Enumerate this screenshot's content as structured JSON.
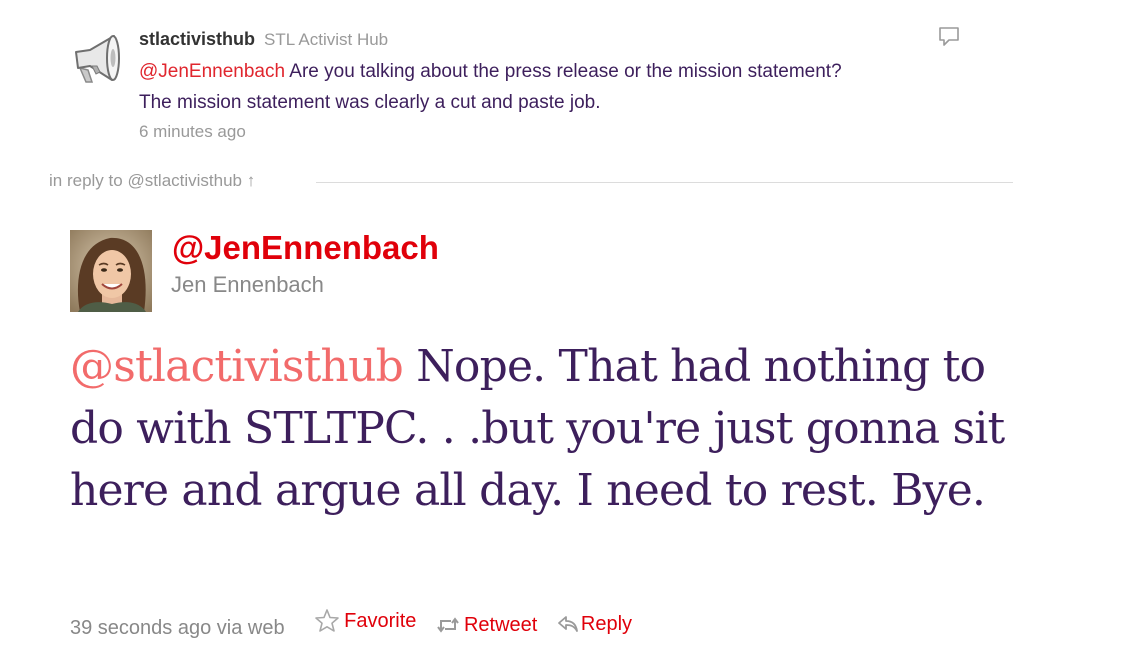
{
  "parent_tweet": {
    "screen_name": "stlactivisthub",
    "full_name": "STL Activist Hub",
    "mention": "@JenEnnenbach",
    "text_rest": "Are you talking about the press release or the mission statement?",
    "text_line2": "The mission statement was clearly a cut and paste job.",
    "timestamp": "6 minutes ago"
  },
  "in_reply": {
    "prefix": "in reply to",
    "link": "@stlactivisthub",
    "arrow": "↑"
  },
  "main_tweet": {
    "screen_name": "@JenEnnenbach",
    "full_name": "Jen Ennenbach",
    "mention": "@stlactivisthub",
    "text": "Nope. That had nothing to do with STLTPC. . .but you're just gonna sit here and argue all day. I need to rest. Bye.",
    "timestamp": "39 seconds ago",
    "via": "via web",
    "actions": {
      "favorite": "Favorite",
      "retweet": "Retweet",
      "reply": "Reply"
    }
  },
  "icons": {
    "parent_avatar": "megaphone-icon",
    "comment": "speech-bubble-icon",
    "favorite": "star-icon",
    "retweet": "retweet-icon",
    "reply": "reply-arrow-icon"
  },
  "colors": {
    "mention_red": "#e0000a",
    "tweet_text_purple": "#3d1f5c",
    "meta_gray": "#888888"
  }
}
